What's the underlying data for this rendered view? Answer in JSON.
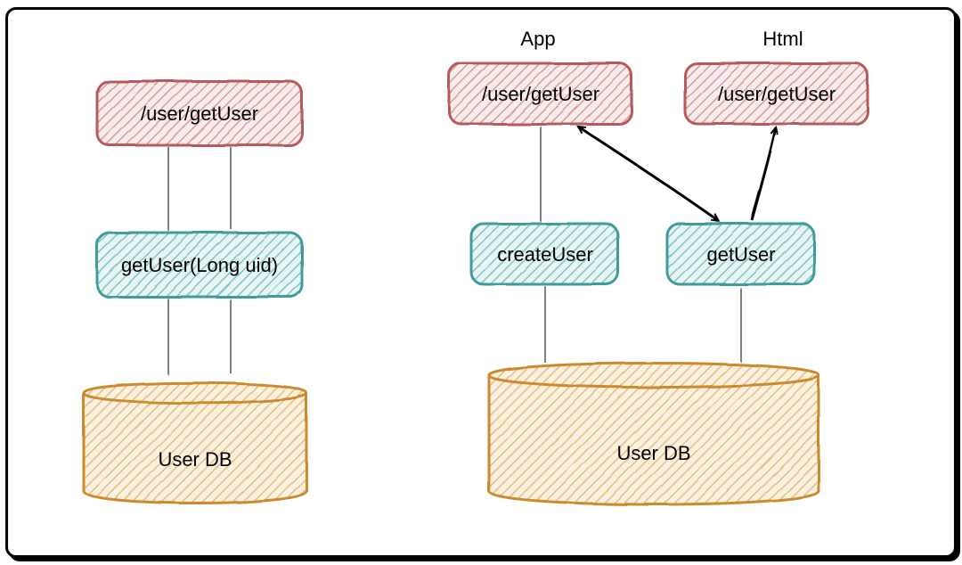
{
  "diagram": {
    "left": {
      "endpoint": "/user/getUser",
      "service": "getUser(Long uid)",
      "db": "User DB"
    },
    "right": {
      "titleApp": "App",
      "titleHtml": "Html",
      "endpointApp": "/user/getUser",
      "endpointHtml": "/user/getUser",
      "serviceCreate": "createUser",
      "serviceGet": "getUser",
      "db": "User DB"
    },
    "colors": {
      "red": "#c05050",
      "redFill": "#f8e6e6",
      "teal": "#3f9b9b",
      "tealFill": "#d8eeee",
      "orange": "#d99a3f",
      "orangeFill": "#f7e6cc"
    }
  }
}
